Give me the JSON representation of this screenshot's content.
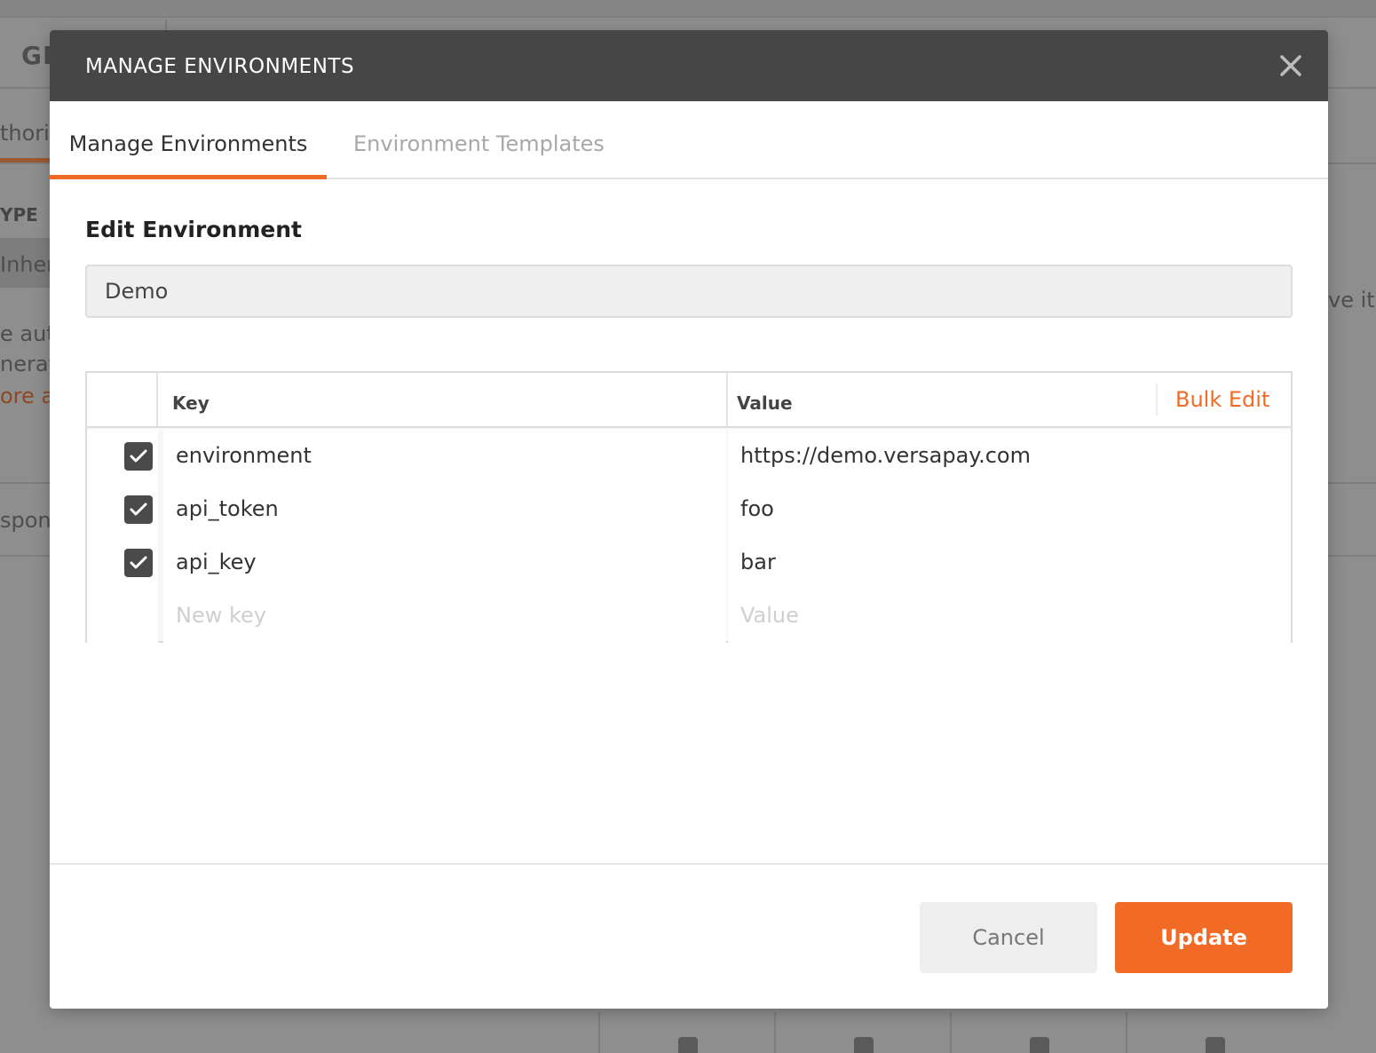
{
  "background": {
    "method_fragment": "GE",
    "tab_fragment": "thoriz",
    "type_fragment": "YPE",
    "inherit_fragment": "Inher",
    "desc_fragment_1": "e aut",
    "desc_fragment_2": "nerat",
    "link_fragment": "ore a",
    "save_fragment": "ve it",
    "response_fragment": "spons"
  },
  "modal": {
    "title": "MANAGE ENVIRONMENTS",
    "close_icon": "close-icon"
  },
  "tabs": [
    {
      "label": "Manage Environments",
      "active": true
    },
    {
      "label": "Environment Templates",
      "active": false
    }
  ],
  "edit": {
    "title": "Edit Environment",
    "environment_name": "Demo"
  },
  "table": {
    "headers": {
      "key": "Key",
      "value": "Value",
      "bulk_edit": "Bulk Edit"
    },
    "rows": [
      {
        "enabled": true,
        "key": "environment",
        "value": "https://demo.versapay.com"
      },
      {
        "enabled": true,
        "key": "api_token",
        "value": "foo"
      },
      {
        "enabled": true,
        "key": "api_key",
        "value": "bar"
      }
    ],
    "new_row": {
      "key_placeholder": "New key",
      "value_placeholder": "Value"
    }
  },
  "footer": {
    "cancel": "Cancel",
    "update": "Update"
  },
  "colors": {
    "accent": "#f26b26",
    "header_bg": "#464646",
    "checkbox": "#4a4a4a"
  }
}
